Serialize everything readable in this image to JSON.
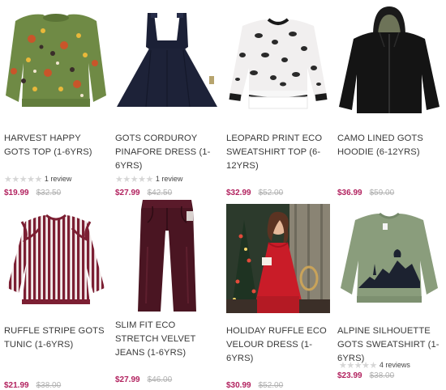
{
  "products": [
    {
      "name": "HARVEST HAPPY GOTS TOP (1-6YRS)",
      "review_text": "1 review",
      "sale_price": "$19.99",
      "was_price": "$32.50",
      "image_icon": "floral-sweatshirt-image"
    },
    {
      "name": "GOTS CORDUROY PINAFORE DRESS (1-6YRS)",
      "review_text": "1 review",
      "sale_price": "$27.99",
      "was_price": "$42.50",
      "image_icon": "navy-pinafore-image"
    },
    {
      "name": "LEOPARD PRINT ECO SWEATSHIRT TOP (6-12YRS)",
      "review_text": "",
      "sale_price": "$32.99",
      "was_price": "$52.00",
      "image_icon": "leopard-sweatshirt-image"
    },
    {
      "name": "CAMO LINED GOTS HOODIE (6-12YRS)",
      "review_text": "",
      "sale_price": "$36.99",
      "was_price": "$59.00",
      "image_icon": "black-hoodie-image"
    },
    {
      "name": "RUFFLE STRIPE GOTS TUNIC (1-6YRS)",
      "review_text": "",
      "sale_price": "$21.99",
      "was_price": "$38.00",
      "image_icon": "striped-tunic-image"
    },
    {
      "name": "SLIM FIT ECO STRETCH VELVET JEANS (1-6YRS)",
      "review_text": "",
      "sale_price": "$27.99",
      "was_price": "$46.00",
      "image_icon": "velvet-jeans-image"
    },
    {
      "name": "HOLIDAY RUFFLE ECO VELOUR DRESS (1-6YRS)",
      "review_text": "",
      "sale_price": "$30.99",
      "was_price": "$52.00",
      "image_icon": "girl-red-dress-photo"
    },
    {
      "name": "ALPINE SILHOUETTE GOTS SWEATSHIRT (1-6YRS)",
      "review_text": "4 reviews",
      "sale_price": "$23.99",
      "was_price": "$38.00",
      "image_icon": "green-sweatshirt-image"
    }
  ],
  "colors": {
    "sale_price": "#b2225f",
    "was_price": "#b0b0b0",
    "stars_empty": "#d6d6d6"
  }
}
